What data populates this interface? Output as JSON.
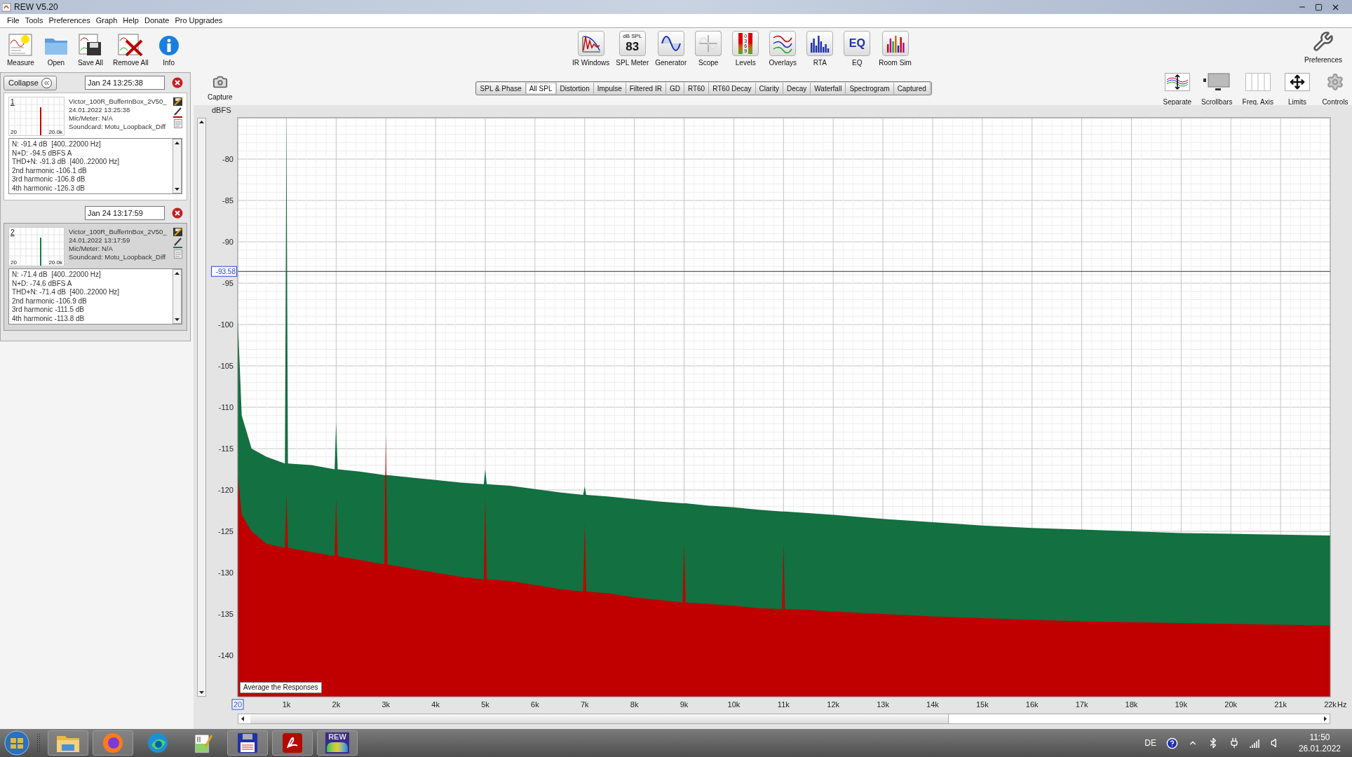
{
  "window": {
    "title": "REW V5.20"
  },
  "menu": [
    "File",
    "Tools",
    "Preferences",
    "Graph",
    "Help",
    "Donate",
    "Pro Upgrades"
  ],
  "toolbar_left": [
    {
      "kind": "measure",
      "label": "Measure"
    },
    {
      "kind": "open",
      "label": "Open"
    },
    {
      "kind": "save",
      "label": "Save All"
    },
    {
      "kind": "remove",
      "label": "Remove All"
    },
    {
      "kind": "info",
      "label": "Info"
    }
  ],
  "toolbar_tools": [
    {
      "kind": "ir",
      "label": "IR Windows"
    },
    {
      "kind": "spl",
      "label": "SPL Meter",
      "icon_text": [
        "dB SPL",
        "83"
      ]
    },
    {
      "kind": "generator",
      "label": "Generator"
    },
    {
      "kind": "scope",
      "label": "Scope"
    },
    {
      "kind": "levels",
      "label": "Levels",
      "icon_text": [
        "0",
        "3",
        "6",
        "9"
      ]
    },
    {
      "kind": "overlays",
      "label": "Overlays"
    },
    {
      "kind": "rta",
      "label": "RTA"
    },
    {
      "kind": "eq",
      "label": "EQ",
      "icon_text": [
        "EQ"
      ]
    },
    {
      "kind": "roomsim",
      "label": "Room Sim"
    }
  ],
  "preferences_button": {
    "label": "Preferences"
  },
  "collapse_button": {
    "label": "Collapse"
  },
  "measurements": [
    {
      "number": "1",
      "date": "Jan 24 13:25:38",
      "name": "Victor_100R_BufferInBox_2V50_",
      "timestamp": "24.01.2022 13:25:38",
      "mic": "Mic/Meter: N/A",
      "soundcard": "Soundcard: Motu_Loopback_Diff",
      "color": "#c00000",
      "selected": false,
      "thumb_min": "20",
      "thumb_max": "20.0k",
      "results": [
        "N: -91.4 dB  [400..22000 Hz]",
        "N+D: -94.5 dBFS A",
        "THD+N: -91.3 dB  [400..22000 Hz]",
        "2nd harmonic -106.1 dB",
        "3rd harmonic -106.8 dB",
        "4th harmonic -126.3 dB"
      ]
    },
    {
      "number": "2",
      "date": "Jan 24 13:17:59",
      "name": "Victor_100R_BufferInBox_2V50_",
      "timestamp": "24.01.2022 13:17:59",
      "mic": "Mic/Meter: N/A",
      "soundcard": "Soundcard: Motu_Loopback_Diff",
      "color": "#1a7a40",
      "selected": true,
      "thumb_min": "20",
      "thumb_max": "20.0k",
      "results": [
        "N: -71.4 dB  [400..22000 Hz]",
        "N+D: -74.6 dBFS A",
        "THD+N: -71.4 dB  [400..22000 Hz]",
        "2nd harmonic -106.9 dB",
        "3rd harmonic -111.5 dB",
        "4th harmonic -113.8 dB"
      ]
    }
  ],
  "capture_button": {
    "label": "Capture"
  },
  "graph_tabs": [
    {
      "label": "SPL & Phase",
      "selected": false
    },
    {
      "label": "All SPL",
      "selected": true
    },
    {
      "label": "Distortion",
      "selected": false
    },
    {
      "label": "Impulse",
      "selected": false
    },
    {
      "label": "Filtered IR",
      "selected": false
    },
    {
      "label": "GD",
      "selected": false
    },
    {
      "label": "RT60",
      "selected": false
    },
    {
      "label": "RT60 Decay",
      "selected": false
    },
    {
      "label": "Clarity",
      "selected": false
    },
    {
      "label": "Decay",
      "selected": false
    },
    {
      "label": "Waterfall",
      "selected": false
    },
    {
      "label": "Spectrogram",
      "selected": false
    },
    {
      "label": "Captured",
      "selected": false
    }
  ],
  "graph_buttons": [
    {
      "kind": "separate",
      "label": "Separate"
    },
    {
      "kind": "scrollbars",
      "label": "Scrollbars"
    },
    {
      "kind": "freqaxis",
      "label": "Freq. Axis"
    },
    {
      "kind": "limits",
      "label": "Limits"
    },
    {
      "kind": "controls",
      "label": "Controls"
    }
  ],
  "graph": {
    "average_button": "Average the Responses",
    "chart_data": {
      "type": "area",
      "ylabel": "dBFS",
      "xlabel": "Hz",
      "grid": true,
      "x": [
        20,
        100,
        300,
        600,
        970,
        1000,
        1030,
        1500,
        1970,
        2000,
        2030,
        2500,
        2970,
        3000,
        3030,
        3500,
        4000,
        4500,
        4970,
        5000,
        5030,
        5500,
        6000,
        6500,
        6970,
        7000,
        7030,
        7500,
        8000,
        8500,
        8970,
        9000,
        9030,
        9500,
        10000,
        10500,
        10970,
        11000,
        11030,
        11500,
        12000,
        13000,
        14000,
        15000,
        16000,
        17000,
        18000,
        19000,
        20000,
        21000,
        22000
      ],
      "series": [
        {
          "color": "#137040",
          "values": [
            -99,
            -111,
            -115,
            -116,
            -116.8,
            -75,
            -116.8,
            -117,
            -117.5,
            -111.8,
            -117.5,
            -117.8,
            -118.2,
            -118.2,
            -118.2,
            -118.5,
            -118.8,
            -119.1,
            -119.3,
            -117.5,
            -119.3,
            -119.5,
            -119.9,
            -120.3,
            -120.6,
            -119.6,
            -120.6,
            -120.8,
            -121.1,
            -121.4,
            -121.6,
            -121.6,
            -121.6,
            -121.9,
            -122.1,
            -122.4,
            -122.6,
            -122.6,
            -122.6,
            -122.8,
            -123,
            -123.5,
            -123.9,
            -124.3,
            -124.6,
            -124.8,
            -125,
            -125.2,
            -125.3,
            -125.4,
            -125.5
          ]
        },
        {
          "color": "#c00000",
          "values": [
            -118,
            -123,
            -125,
            -126.5,
            -127,
            -120.5,
            -127,
            -127.5,
            -128,
            -121,
            -128,
            -128.5,
            -129,
            -113.3,
            -129,
            -129.5,
            -130,
            -130.5,
            -130.8,
            -121,
            -130.8,
            -131,
            -131.5,
            -132,
            -132.3,
            -124,
            -132.3,
            -132.5,
            -133,
            -133.3,
            -133.6,
            -126.5,
            -133.6,
            -133.8,
            -134,
            -134.3,
            -134.4,
            -126.5,
            -134.4,
            -134.5,
            -134.7,
            -135,
            -135.3,
            -135.5,
            -135.7,
            -135.9,
            -136,
            -136.1,
            -136.2,
            -136.3,
            -136.4
          ]
        }
      ],
      "xlim": [
        20,
        22000
      ],
      "ylim": [
        -145,
        -75
      ],
      "xticks": [
        {
          "value": 20,
          "label": "20"
        },
        {
          "value": 1000,
          "label": "1k"
        },
        {
          "value": 2000,
          "label": "2k"
        },
        {
          "value": 3000,
          "label": "3k"
        },
        {
          "value": 4000,
          "label": "4k"
        },
        {
          "value": 5000,
          "label": "5k"
        },
        {
          "value": 6000,
          "label": "6k"
        },
        {
          "value": 7000,
          "label": "7k"
        },
        {
          "value": 8000,
          "label": "8k"
        },
        {
          "value": 9000,
          "label": "9k"
        },
        {
          "value": 10000,
          "label": "10k"
        },
        {
          "value": 11000,
          "label": "11k"
        },
        {
          "value": 12000,
          "label": "12k"
        },
        {
          "value": 13000,
          "label": "13k"
        },
        {
          "value": 14000,
          "label": "14k"
        },
        {
          "value": 15000,
          "label": "15k"
        },
        {
          "value": 16000,
          "label": "16k"
        },
        {
          "value": 17000,
          "label": "17k"
        },
        {
          "value": 18000,
          "label": "18k"
        },
        {
          "value": 19000,
          "label": "19k"
        },
        {
          "value": 20000,
          "label": "20k"
        },
        {
          "value": 21000,
          "label": "21k"
        },
        {
          "value": 22000,
          "label": "22k"
        }
      ],
      "yticks": [
        -80,
        -85,
        -90,
        -95,
        -100,
        -105,
        -110,
        -115,
        -120,
        -125,
        -130,
        -135,
        -140
      ],
      "ref_lines": [
        {
          "axis": "y",
          "value": -93.58,
          "label": "-93.58"
        }
      ]
    }
  },
  "taskbar": {
    "apps": [
      {
        "kind": "explorer",
        "running": true
      },
      {
        "kind": "firefox",
        "running": true
      },
      {
        "kind": "edge",
        "running": false
      },
      {
        "kind": "notepad",
        "running": false
      },
      {
        "kind": "floppy",
        "running": true
      },
      {
        "kind": "acrobat",
        "running": true
      },
      {
        "kind": "rew",
        "running": true,
        "icon_text": "REW"
      }
    ],
    "tray": {
      "language": "DE",
      "time": "11:50",
      "date": "26.01.2022"
    }
  }
}
